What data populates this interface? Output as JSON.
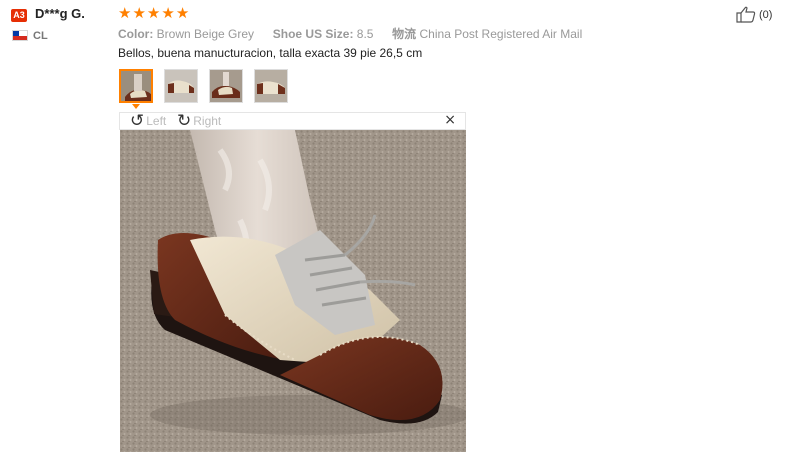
{
  "reviewer": {
    "level_badge": "A3",
    "name": "D***g G.",
    "country_code": "CL",
    "flag_colors": [
      "#0039a6",
      "#ffffff",
      "#d52b1e"
    ]
  },
  "rating": {
    "stars": 5,
    "max": 5,
    "color": "#ff8000"
  },
  "attributes": [
    {
      "key": "Color:",
      "value": "Brown Beige Grey"
    },
    {
      "key": "Shoe US Size:",
      "value": "8.5"
    },
    {
      "key": "物流",
      "value": "China Post Registered Air Mail"
    }
  ],
  "review_text": "Bellos, buena manucturacion, talla exacta 39 pie 26,5 cm",
  "thumbnails": {
    "count": 4,
    "active_index": 0,
    "active_color": "#ff8000"
  },
  "viewer": {
    "rotate_left_label": "Left",
    "rotate_right_label": "Right",
    "close_symbol": "×",
    "rotate_left_icon": "rotate-left-icon",
    "rotate_right_icon": "rotate-right-icon"
  },
  "helpful": {
    "count_text": "(0)",
    "icon": "thumbs-up-icon"
  }
}
